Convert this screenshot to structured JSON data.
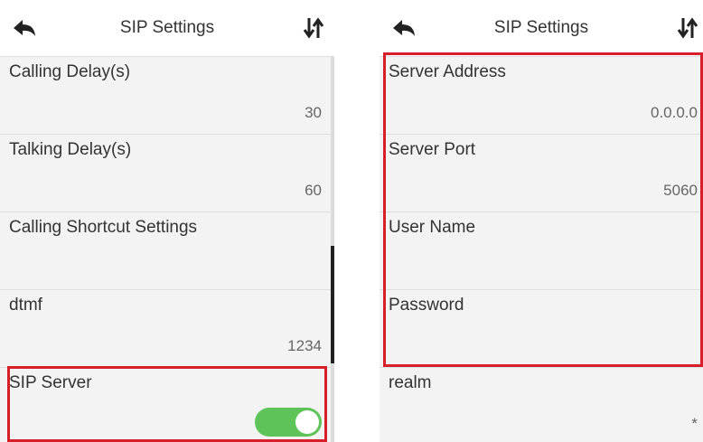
{
  "left": {
    "title": "SIP Settings",
    "items": [
      {
        "label": "Calling Delay(s)",
        "value": "30"
      },
      {
        "label": "Talking Delay(s)",
        "value": "60"
      },
      {
        "label": "Calling Shortcut Settings",
        "value": ""
      },
      {
        "label": "dtmf",
        "value": "1234"
      },
      {
        "label": "SIP Server",
        "value": ""
      }
    ],
    "sip_server_toggle_on": true
  },
  "right": {
    "title": "SIP Settings",
    "items": [
      {
        "label": "Server Address",
        "value": "0.0.0.0"
      },
      {
        "label": "Server Port",
        "value": "5060"
      },
      {
        "label": "User Name",
        "value": ""
      },
      {
        "label": "Password",
        "value": ""
      },
      {
        "label": "realm",
        "value": "*"
      }
    ]
  },
  "colors": {
    "highlight": "#d71e2b",
    "toggle_on": "#5ec45a"
  }
}
